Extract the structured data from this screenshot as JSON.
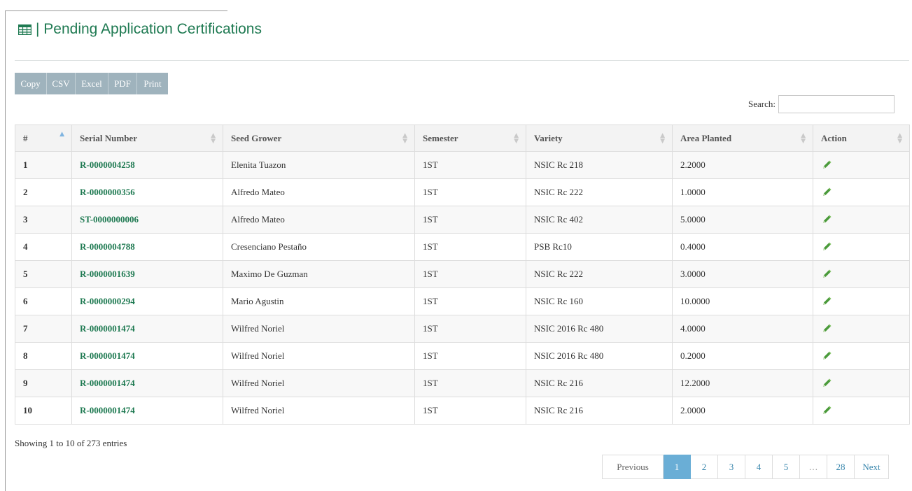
{
  "header": {
    "title": "| Pending Application Certifications"
  },
  "toolbar": {
    "buttons": [
      "Copy",
      "CSV",
      "Excel",
      "PDF",
      "Print"
    ]
  },
  "search": {
    "label": "Search:",
    "value": ""
  },
  "table": {
    "columns": [
      "#",
      "Serial Number",
      "Seed Grower",
      "Semester",
      "Variety",
      "Area Planted",
      "Action"
    ],
    "rows": [
      {
        "num": "1",
        "serial": "R-0000004258",
        "grower": "Elenita Tuazon",
        "semester": "1ST",
        "variety": "NSIC Rc 218",
        "area": "2.2000"
      },
      {
        "num": "2",
        "serial": "R-0000000356",
        "grower": "Alfredo Mateo",
        "semester": "1ST",
        "variety": "NSIC Rc 222",
        "area": "1.0000"
      },
      {
        "num": "3",
        "serial": "ST-0000000006",
        "grower": "Alfredo Mateo",
        "semester": "1ST",
        "variety": "NSIC Rc 402",
        "area": "5.0000"
      },
      {
        "num": "4",
        "serial": "R-0000004788",
        "grower": "Cresenciano Pestaño",
        "semester": "1ST",
        "variety": "PSB Rc10",
        "area": "0.4000"
      },
      {
        "num": "5",
        "serial": "R-0000001639",
        "grower": "Maximo De Guzman",
        "semester": "1ST",
        "variety": "NSIC Rc 222",
        "area": "3.0000"
      },
      {
        "num": "6",
        "serial": "R-0000000294",
        "grower": "Mario Agustin",
        "semester": "1ST",
        "variety": "NSIC Rc 160",
        "area": "10.0000"
      },
      {
        "num": "7",
        "serial": "R-0000001474",
        "grower": "Wilfred Noriel",
        "semester": "1ST",
        "variety": "NSIC 2016 Rc 480",
        "area": "4.0000"
      },
      {
        "num": "8",
        "serial": "R-0000001474",
        "grower": "Wilfred Noriel",
        "semester": "1ST",
        "variety": "NSIC 2016 Rc 480",
        "area": "0.2000"
      },
      {
        "num": "9",
        "serial": "R-0000001474",
        "grower": "Wilfred Noriel",
        "semester": "1ST",
        "variety": "NSIC Rc 216",
        "area": "12.2000"
      },
      {
        "num": "10",
        "serial": "R-0000001474",
        "grower": "Wilfred Noriel",
        "semester": "1ST",
        "variety": "NSIC Rc 216",
        "area": "2.0000"
      }
    ],
    "action_icon": "pencil-icon"
  },
  "info": {
    "text": "Showing 1 to 10 of 273 entries"
  },
  "pagination": {
    "previous": "Previous",
    "pages": [
      "1",
      "2",
      "3",
      "4",
      "5",
      "…",
      "28"
    ],
    "next": "Next",
    "active": "1"
  },
  "colors": {
    "accent": "#1f7a52",
    "button_bg": "#9fb3bd",
    "active_page": "#6aaed6"
  }
}
